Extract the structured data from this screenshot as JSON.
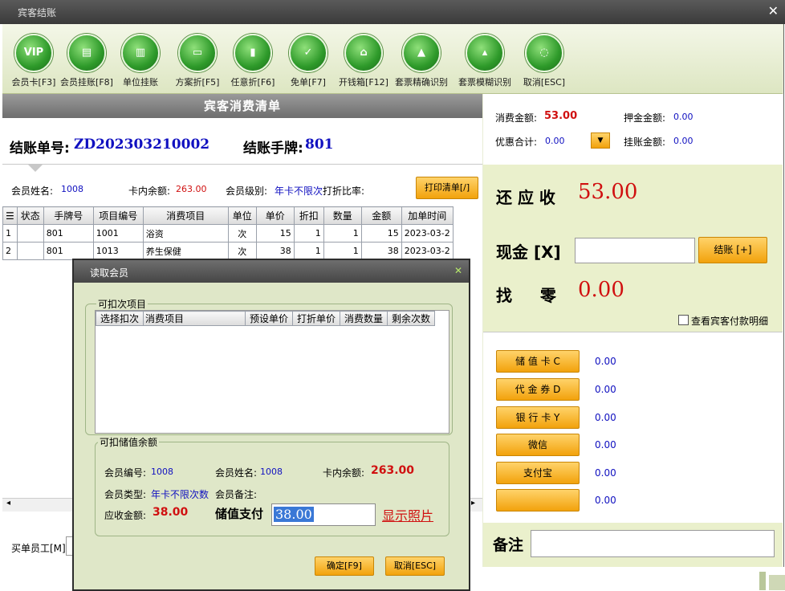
{
  "window": {
    "title": "宾客结账",
    "close": "✕"
  },
  "toolbar": [
    {
      "label": "会员卡[F3]",
      "icon": "vip-icon",
      "glyph": "VIP"
    },
    {
      "label": "会员挂账[F8]",
      "icon": "member-credit-icon",
      "glyph": "▤"
    },
    {
      "label": "单位挂账",
      "icon": "company-credit-icon",
      "glyph": "▥"
    },
    {
      "label": "方案折[F5]",
      "icon": "plan-discount-icon",
      "glyph": "▭"
    },
    {
      "label": "任意折[F6]",
      "icon": "any-discount-icon",
      "glyph": "▮"
    },
    {
      "label": "免单[F7]",
      "icon": "free-order-icon",
      "glyph": "✓"
    },
    {
      "label": "开钱箱[F12]",
      "icon": "cash-drawer-icon",
      "glyph": "⌂"
    },
    {
      "label": "套票精确识别",
      "icon": "ticket-exact-icon",
      "glyph": "▲"
    },
    {
      "label": "套票模糊识别",
      "icon": "ticket-fuzzy-icon",
      "glyph": "▴"
    },
    {
      "label": "取消[ESC]",
      "icon": "cancel-icon",
      "glyph": "◌"
    }
  ],
  "bill": {
    "title": "宾客消费清单",
    "order_label": "结账单号:",
    "order_no": "ZD202303210002",
    "tag_label": "结账手牌:",
    "tag_no": "801",
    "member_name_label": "会员姓名:",
    "member_name": "1008",
    "balance_label": "卡内余额:",
    "balance": "263.00",
    "level_label": "会员级别:",
    "level": "年卡不限次",
    "ratio_label": "打折比率:",
    "print_btn": "打印清单[/]"
  },
  "grid": {
    "headers": [
      "☰",
      "状态",
      "手牌号",
      "项目编号",
      "消费项目",
      "单位",
      "单价",
      "折扣",
      "数量",
      "金额",
      "加单时间"
    ],
    "rows": [
      [
        "1",
        "",
        "801",
        "1001",
        "浴资",
        "次",
        "15",
        "1",
        "1",
        "15",
        "2023-03-2"
      ],
      [
        "2",
        "",
        "801",
        "1013",
        "养生保健",
        "次",
        "38",
        "1",
        "1",
        "38",
        "2023-03-2"
      ]
    ]
  },
  "footer": {
    "staff_label": "买单员工[M]"
  },
  "summary": {
    "consume_label": "消费金额:",
    "consume": "53.00",
    "deposit_label": "押金金额:",
    "deposit": "0.00",
    "discount_label": "优惠合计:",
    "discount": "0.00",
    "credit_label": "挂账金额:",
    "credit": "0.00"
  },
  "payment": {
    "due_label": "还 应 收",
    "due": "53.00",
    "cash_label": "现金 [X]",
    "cash_value": "",
    "checkout_btn": "结账 [+]",
    "change_label": "找     零",
    "change": "0.00",
    "detail_checkbox": "查看宾客付款明细",
    "methods": [
      {
        "label": "储 值 卡 C",
        "value": "0.00"
      },
      {
        "label": "代 金 券 D",
        "value": "0.00"
      },
      {
        "label": "银 行 卡 Y",
        "value": "0.00"
      },
      {
        "label": "微信",
        "value": "0.00"
      },
      {
        "label": "支付宝",
        "value": "0.00"
      },
      {
        "label": "",
        "value": "0.00"
      }
    ],
    "remark_label": "备注",
    "remark_value": ""
  },
  "dialog": {
    "title": "读取会员",
    "close": "✕",
    "group1_title": "可扣次项目",
    "group1_headers": [
      "选择扣次",
      "消费项目",
      "预设单价",
      "打折单价",
      "消费数量",
      "剩余次数"
    ],
    "group2_title": "可扣储值余额",
    "member_no_label": "会员编号:",
    "member_no": "1008",
    "member_name_label": "会员姓名:",
    "member_name": "1008",
    "card_balance_label": "卡内余额:",
    "card_balance": "263.00",
    "member_type_label": "会员类型:",
    "member_type": "年卡不限次数",
    "member_remark_label": "会员备注:",
    "due_label": "应收金额:",
    "due": "38.00",
    "stored_pay_label": "储值支付",
    "stored_pay": "38.00",
    "photo_link": "显示照片",
    "ok_btn": "确定[F9]",
    "cancel_btn": "取消[ESC]"
  }
}
